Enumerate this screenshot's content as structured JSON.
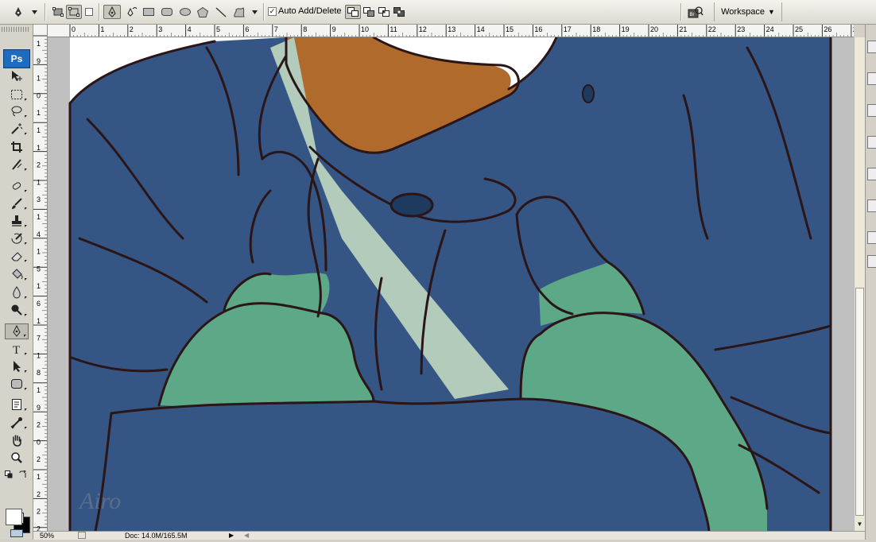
{
  "options_bar": {
    "auto_add_delete_label": "Auto Add/Delete",
    "auto_add_delete_checked": true,
    "workspace_label": "Workspace"
  },
  "toolbox": {
    "logo": "Ps",
    "tools": [
      "move-tool-icon",
      "marquee-tool-icon",
      "lasso-tool-icon",
      "magic-wand-tool-icon",
      "crop-tool-icon",
      "slice-tool-icon",
      "healing-brush-tool-icon",
      "brush-tool-icon",
      "clone-stamp-tool-icon",
      "history-brush-tool-icon",
      "eraser-tool-icon",
      "paint-bucket-tool-icon",
      "blur-tool-icon",
      "dodge-tool-icon",
      "pen-tool-icon",
      "type-tool-icon",
      "path-selection-tool-icon",
      "shape-tool-icon",
      "notes-tool-icon",
      "eyedropper-tool-icon",
      "hand-tool-icon",
      "zoom-tool-icon"
    ],
    "foreground_color": "#ffffff",
    "background_color": "#000000"
  },
  "ruler": {
    "h_labels": [
      "0",
      "1",
      "2",
      "3",
      "4",
      "5",
      "6",
      "7",
      "8",
      "9",
      "10",
      "11",
      "12",
      "13",
      "14",
      "15",
      "16",
      "17",
      "18",
      "19",
      "20",
      "21",
      "22",
      "23",
      "24",
      "25",
      "26",
      "27"
    ],
    "v_labels": [
      "1",
      "9",
      "1",
      "0",
      "1",
      "1",
      "1",
      "2",
      "1",
      "3",
      "1",
      "4",
      "1",
      "5",
      "1",
      "6",
      "1",
      "7",
      "1",
      "8",
      "1",
      "9",
      "2",
      "0",
      "2",
      "1",
      "2",
      "2",
      "2",
      "3"
    ]
  },
  "canvas": {
    "signature": "Airo",
    "colors": {
      "jacket": "#355684",
      "outline": "#2a1517",
      "hair": "#b06a2c",
      "strap": "#b3cbbb",
      "gloves": "#5da886",
      "background": "#ffffff"
    }
  },
  "status": {
    "zoom": "50%",
    "doc_info": "Doc: 14.0M/165.5M"
  }
}
